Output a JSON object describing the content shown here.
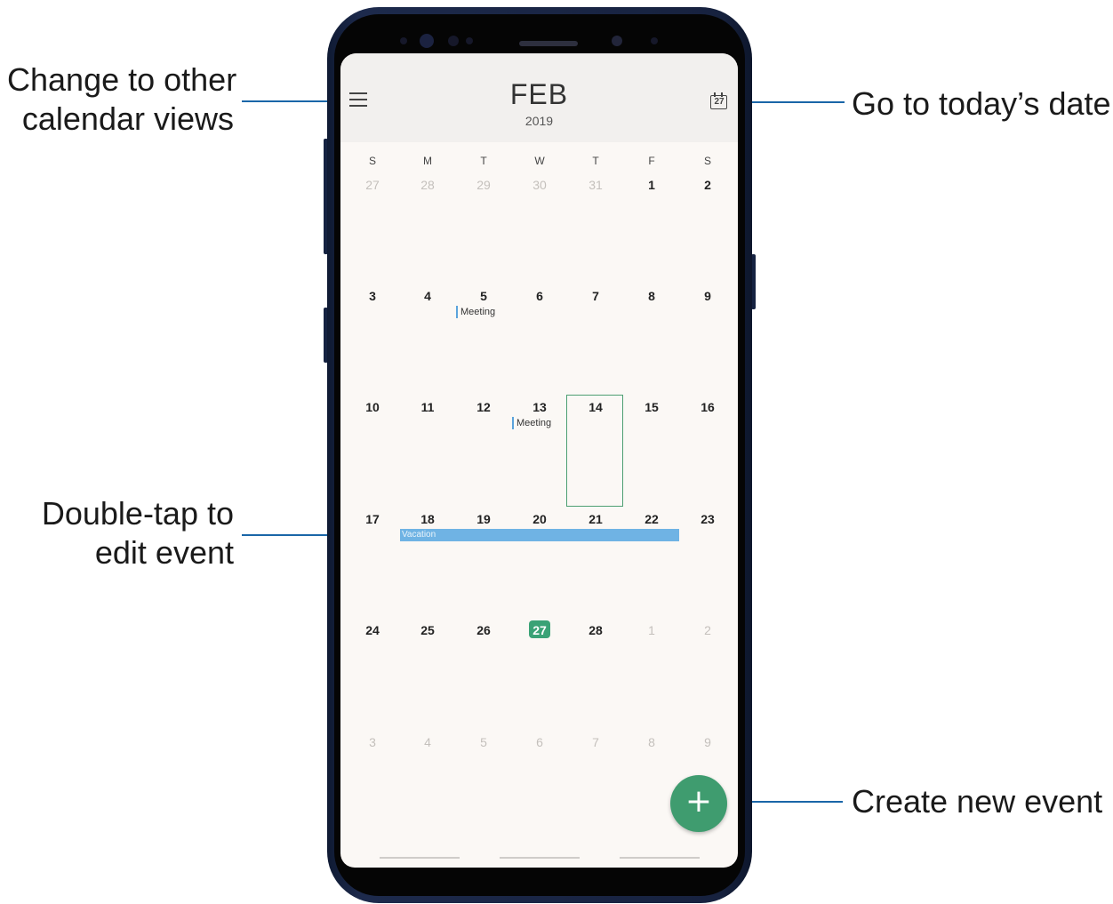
{
  "callouts": {
    "left_top": [
      "Change to other",
      "calendar views"
    ],
    "right_top": "Go to today’s date",
    "left_bottom": [
      "Double-tap to",
      "edit event"
    ],
    "right_bottom": "Create new event"
  },
  "calendar": {
    "month": "FEB",
    "year": "2019",
    "today_icon_number": "27",
    "weekdays": [
      "S",
      "M",
      "T",
      "W",
      "T",
      "F",
      "S"
    ],
    "weeks": [
      [
        {
          "d": "27",
          "muted": true
        },
        {
          "d": "28",
          "muted": true
        },
        {
          "d": "29",
          "muted": true
        },
        {
          "d": "30",
          "muted": true
        },
        {
          "d": "31",
          "muted": true
        },
        {
          "d": "1"
        },
        {
          "d": "2"
        }
      ],
      [
        {
          "d": "3"
        },
        {
          "d": "4"
        },
        {
          "d": "5"
        },
        {
          "d": "6"
        },
        {
          "d": "7"
        },
        {
          "d": "8"
        },
        {
          "d": "9"
        }
      ],
      [
        {
          "d": "10"
        },
        {
          "d": "11"
        },
        {
          "d": "12"
        },
        {
          "d": "13"
        },
        {
          "d": "14"
        },
        {
          "d": "15"
        },
        {
          "d": "16"
        }
      ],
      [
        {
          "d": "17"
        },
        {
          "d": "18"
        },
        {
          "d": "19"
        },
        {
          "d": "20"
        },
        {
          "d": "21"
        },
        {
          "d": "22"
        },
        {
          "d": "23"
        }
      ],
      [
        {
          "d": "24"
        },
        {
          "d": "25"
        },
        {
          "d": "26"
        },
        {
          "d": "27",
          "today": true
        },
        {
          "d": "28"
        },
        {
          "d": "1",
          "muted": true
        },
        {
          "d": "2",
          "muted": true
        }
      ],
      [
        {
          "d": "3",
          "muted": true
        },
        {
          "d": "4",
          "muted": true
        },
        {
          "d": "5",
          "muted": true
        },
        {
          "d": "6",
          "muted": true
        },
        {
          "d": "7",
          "muted": true
        },
        {
          "d": "8",
          "muted": true
        },
        {
          "d": "9",
          "muted": true
        }
      ]
    ],
    "events": {
      "meeting_feb5": "Meeting",
      "meeting_feb13": "Meeting",
      "vacation": "Vacation"
    },
    "selected_day": "14",
    "fab_symbol": "+"
  },
  "colors": {
    "accent_green": "#3f9c6f",
    "today_badge": "#3aa276",
    "event_blue": "#6fb3e4",
    "callout_line": "#1a66a8",
    "phone_body": "#1d2a4c"
  }
}
